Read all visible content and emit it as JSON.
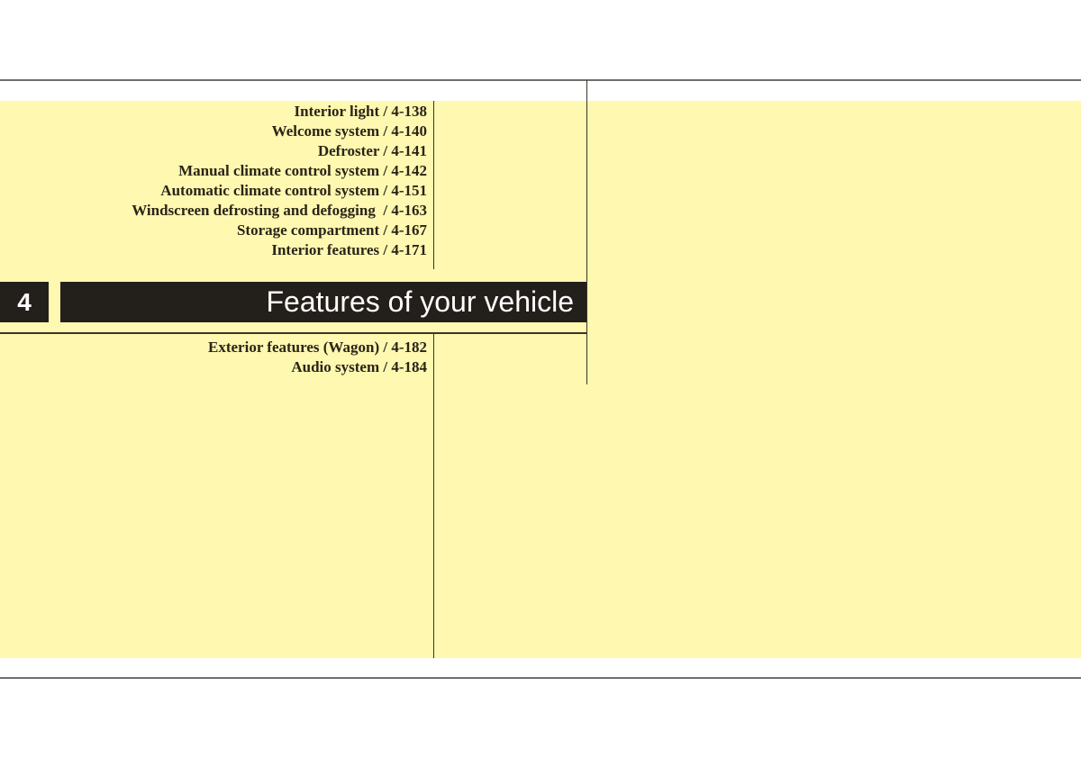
{
  "chapter": {
    "number": "4",
    "title": "Features of your vehicle"
  },
  "toc_top": [
    "Interior light / 4-138",
    "Welcome system / 4-140",
    "Defroster / 4-141",
    "Manual climate control system / 4-142",
    "Automatic climate control system / 4-151",
    "Windscreen defrosting and defogging  / 4-163",
    "Storage compartment / 4-167",
    "Interior features / 4-171"
  ],
  "toc_bottom": [
    "Exterior features (Wagon) / 4-182",
    "Audio system / 4-184"
  ],
  "colors": {
    "background_highlight": "#fff8b0",
    "bar": "#231f1a",
    "text": "#2a2418"
  }
}
